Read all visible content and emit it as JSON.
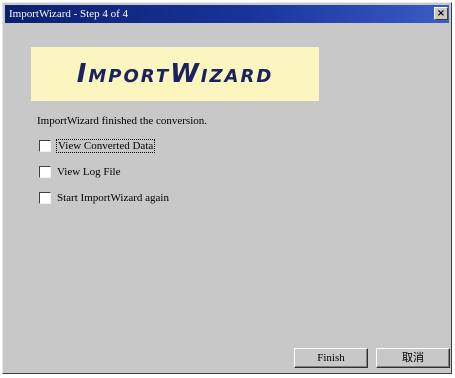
{
  "window": {
    "title": "ImportWizard - Step 4 of 4",
    "close_glyph": "×"
  },
  "banner": {
    "text": "ImportWizard"
  },
  "message": "ImportWizard finished the conversion.",
  "options": [
    {
      "label": "View Converted Data",
      "checked": false
    },
    {
      "label": "View Log File",
      "checked": false
    },
    {
      "label": "Start ImportWizard again",
      "checked": false
    }
  ],
  "buttons": {
    "finish": "Finish",
    "cancel": "取消"
  },
  "colors": {
    "titlebar": "#18349a",
    "banner_bg": "#fbf6c0",
    "banner_text": "#1a2260",
    "window_bg": "#c8c8c8"
  }
}
